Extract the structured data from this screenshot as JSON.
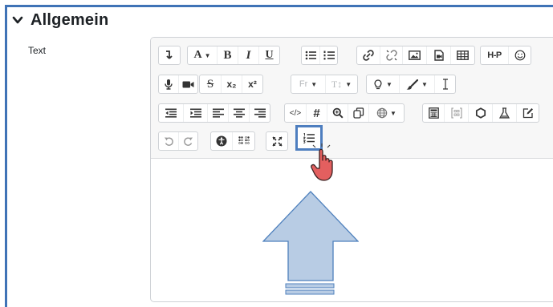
{
  "section": {
    "title": "Allgemein",
    "icon": "chevron-down-icon"
  },
  "field": {
    "label": "Text"
  },
  "toolbar": {
    "row1": {
      "format_icon": "paragraph-format-icon",
      "font_size_letter": "A",
      "bold": "B",
      "italic": "I",
      "underline": "U",
      "h5p_label": "H-P"
    },
    "row2": {
      "subscript": "x₂",
      "superscript": "x²",
      "font_family": "Fr",
      "line_height": "T↕"
    },
    "row3": {
      "code_label": "</>",
      "hash_label": "#"
    },
    "row4": {}
  },
  "colors": {
    "accent": "#3f73b6",
    "highlight_border": "#4e7ebf",
    "cursor": "#e35f5f",
    "arrow_fill": "#b8cce4",
    "arrow_stroke": "#4f81bd"
  }
}
